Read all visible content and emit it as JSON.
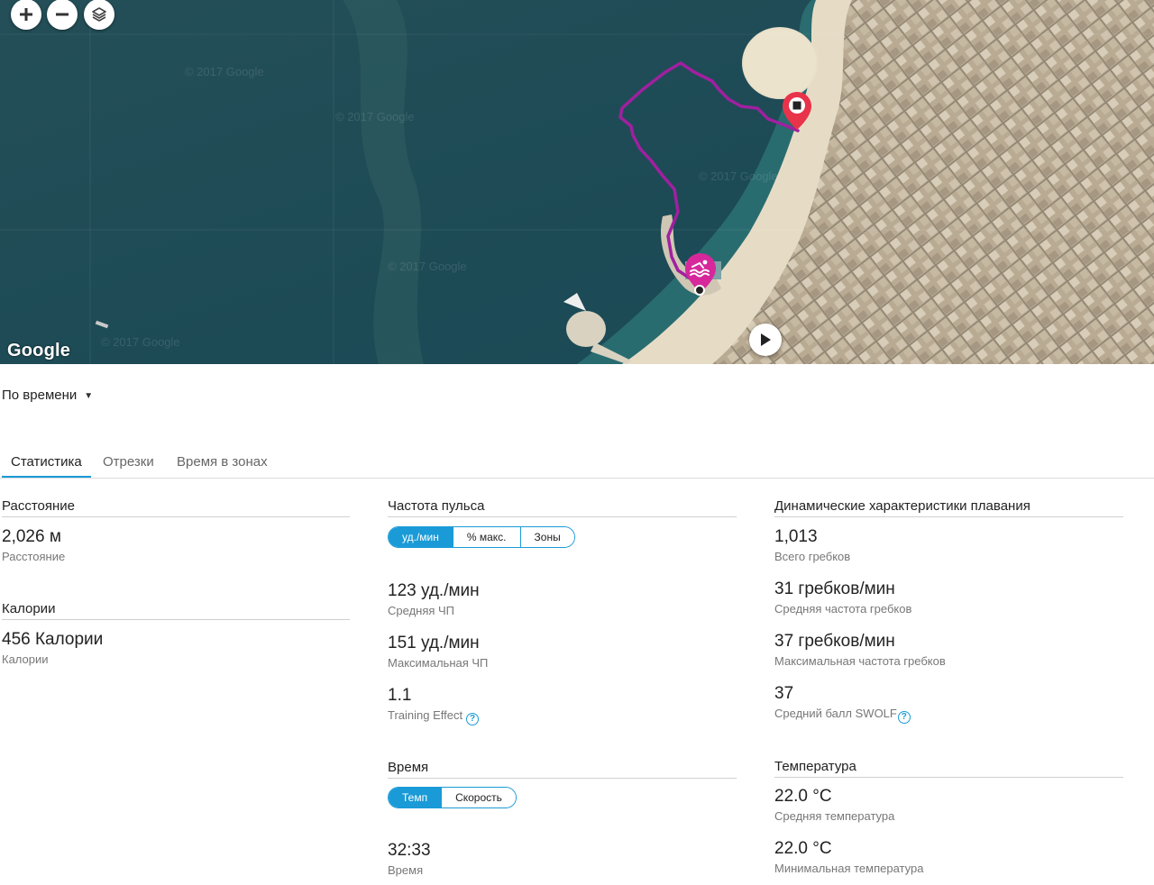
{
  "map": {
    "watermark": "© 2017 Google",
    "google_logo": "Google",
    "controls": {
      "zoom_in_icon": "plus-icon",
      "zoom_out_icon": "minus-icon",
      "layers_icon": "layers-icon",
      "play_icon": "play-icon"
    },
    "route_color": "#a020a0",
    "start_marker_color": "#d6289b",
    "end_marker_color": "#e8334a"
  },
  "x_axis_select": {
    "value": "По времени"
  },
  "tabs": [
    {
      "label": "Статистика",
      "active": true
    },
    {
      "label": "Отрезки",
      "active": false
    },
    {
      "label": "Время в зонах",
      "active": false
    }
  ],
  "distance": {
    "title": "Расстояние",
    "value": "2,026 м",
    "label": "Расстояние"
  },
  "calories": {
    "title": "Калории",
    "value": "456 Калории",
    "label": "Калории"
  },
  "heart_rate": {
    "title": "Частота пульса",
    "options": [
      "уд./мин",
      "% макс.",
      "Зоны"
    ],
    "selected": "уд./мин",
    "avg_value": "123 уд./мин",
    "avg_label": "Средняя ЧП",
    "max_value": "151 уд./мин",
    "max_label": "Максимальная ЧП",
    "te_value": "1.1",
    "te_label": "Training Effect"
  },
  "time": {
    "title": "Время",
    "options": [
      "Темп",
      "Скорость"
    ],
    "selected": "Темп",
    "value": "32:33",
    "label": "Время"
  },
  "swim_dynamics": {
    "title": "Динамические характеристики плавания",
    "total_strokes_value": "1,013",
    "total_strokes_label": "Всего гребков",
    "avg_rate_value": "31 гребков/мин",
    "avg_rate_label": "Средняя частота гребков",
    "max_rate_value": "37 гребков/мин",
    "max_rate_label": "Максимальная частота гребков",
    "swolf_value": "37",
    "swolf_label": "Средний балл SWOLF"
  },
  "temperature": {
    "title": "Температура",
    "avg_value": "22.0 °C",
    "avg_label": "Средняя температура",
    "min_value": "22.0 °C",
    "min_label": "Минимальная температура"
  },
  "accent_color": "#1a9bd7"
}
